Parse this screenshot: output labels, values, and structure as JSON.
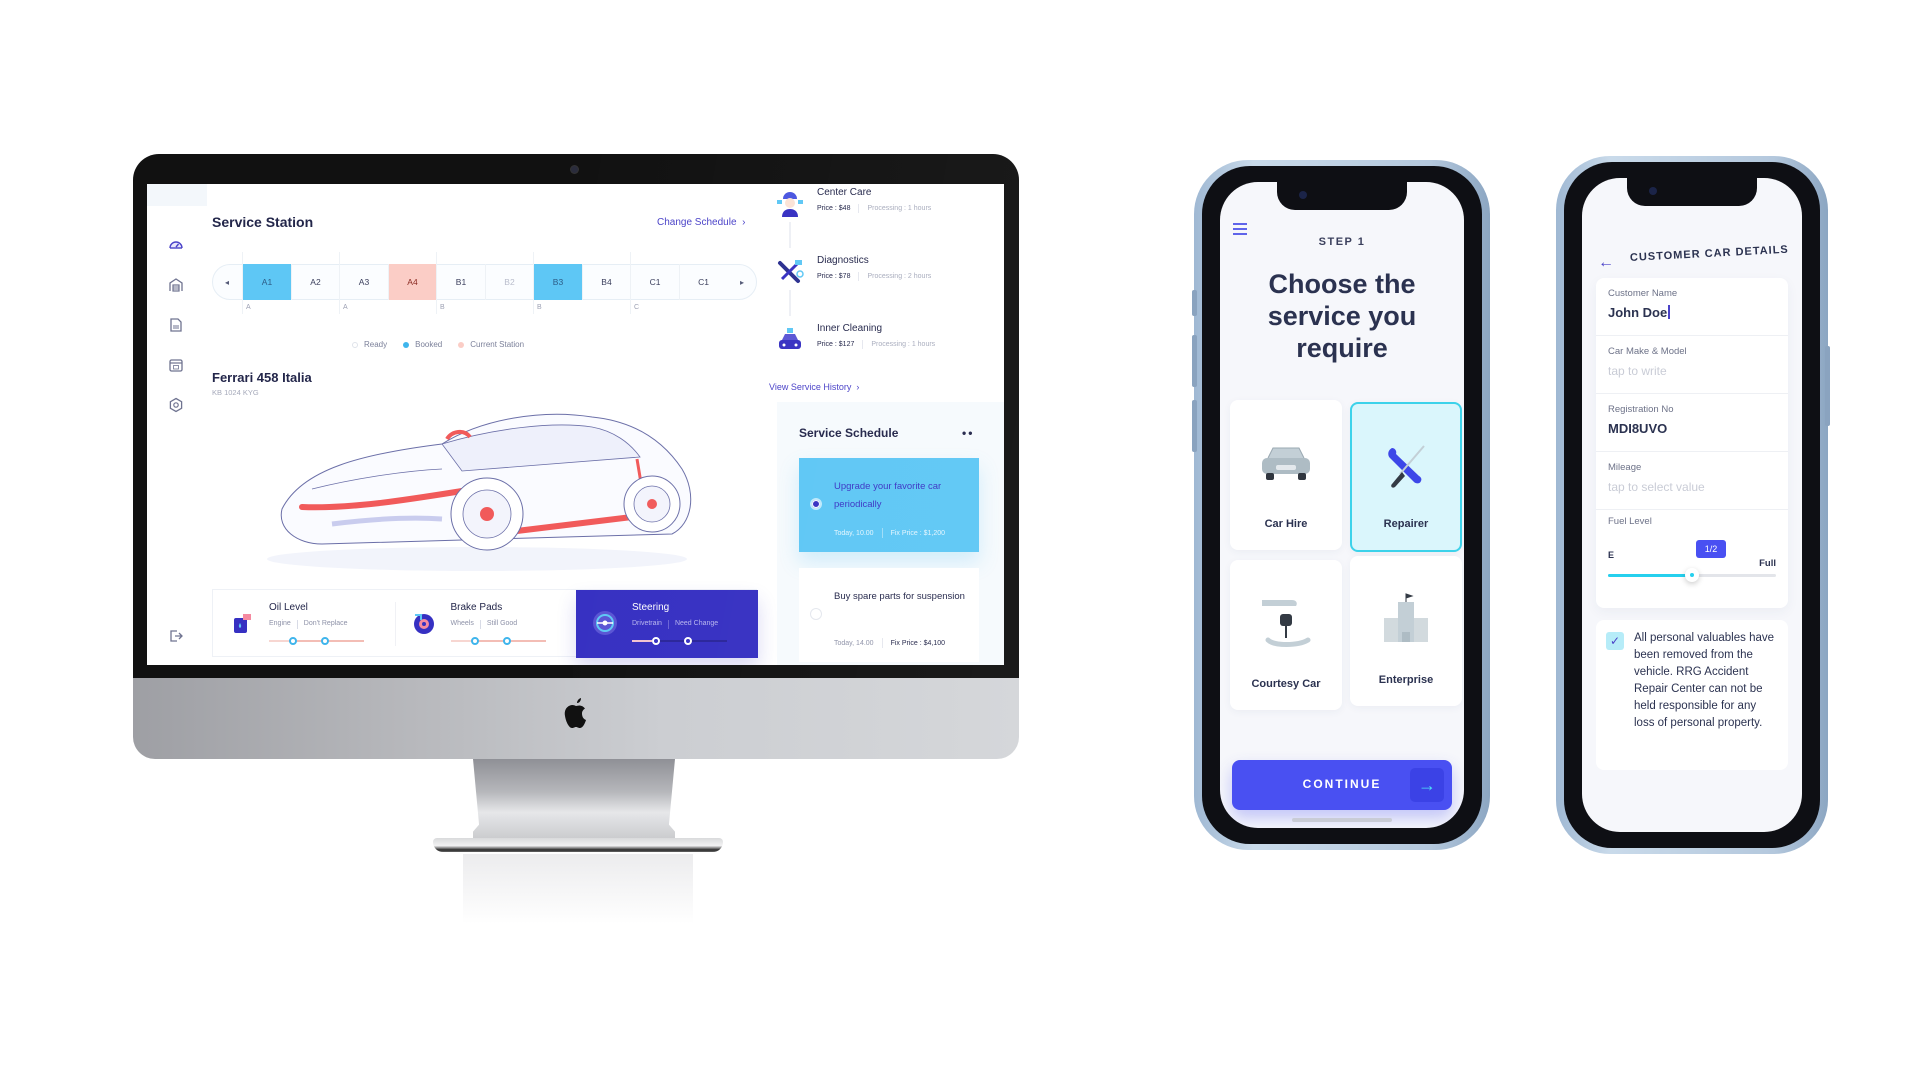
{
  "desktop": {
    "sidebar": {
      "items": [
        {
          "name": "dashboard",
          "icon": "speedometer-icon",
          "active": true
        },
        {
          "name": "garage",
          "icon": "garage-icon",
          "active": false
        },
        {
          "name": "documents",
          "icon": "document-icon",
          "active": false
        },
        {
          "name": "calendar",
          "icon": "calendar-icon",
          "active": false
        },
        {
          "name": "settings",
          "icon": "gear-icon",
          "active": false
        }
      ],
      "logout_icon": "logout-icon"
    },
    "service_station": {
      "title": "Service Station",
      "change_schedule_label": "Change Schedule",
      "change_schedule_chevron": "›",
      "prev_label": "◂",
      "next_label": "▸",
      "slots": [
        {
          "label": "A1",
          "state": "booked"
        },
        {
          "label": "A2",
          "state": "ready"
        },
        {
          "label": "A3",
          "state": "ready"
        },
        {
          "label": "A4",
          "state": "current"
        },
        {
          "label": "B1",
          "state": "ready"
        },
        {
          "label": "B2",
          "state": "disabled"
        },
        {
          "label": "B3",
          "state": "booked"
        },
        {
          "label": "B4",
          "state": "ready"
        },
        {
          "label": "C1",
          "state": "ready"
        },
        {
          "label": "C1",
          "state": "ready"
        }
      ],
      "group_labels": [
        "A",
        "A",
        "B",
        "B",
        "C"
      ],
      "legend": [
        {
          "label": "Ready",
          "color": "#ffffff"
        },
        {
          "label": "Booked",
          "color": "#3fb5ec"
        },
        {
          "label": "Current Station",
          "color": "#fbcdc6"
        }
      ]
    },
    "vehicle": {
      "name": "Ferrari 458 Italia",
      "plate": "KB 1024 KYG"
    },
    "status_cards": [
      {
        "title": "Oil Level",
        "category": "Engine",
        "status": "Don't Replace",
        "icon": "oil-can-icon",
        "active": false
      },
      {
        "title": "Brake Pads",
        "category": "Wheels",
        "status": "Still Good",
        "icon": "brake-disc-icon",
        "active": false
      },
      {
        "title": "Steering",
        "category": "Drivetrain",
        "status": "Need Change",
        "icon": "steering-wheel-icon",
        "active": true
      }
    ],
    "services": [
      {
        "name": "Center Care",
        "price": "Price : $48",
        "processing": "Processing : 1 hours",
        "icon": "mechanic-icon"
      },
      {
        "name": "Diagnostics",
        "price": "Price : $78",
        "processing": "Processing : 2 hours",
        "icon": "wrench-screwdriver-icon"
      },
      {
        "name": "Inner Cleaning",
        "price": "Price : $127",
        "processing": "Processing : 1 hours",
        "icon": "car-wash-icon"
      }
    ],
    "view_history_label": "View Service History",
    "view_history_chevron": "›",
    "schedule": {
      "title": "Service Schedule",
      "more_label": "••",
      "items": [
        {
          "text": "Upgrade your favorite car periodically",
          "time": "Today, 10.00",
          "price": "Fix Price : $1,200",
          "selected": true
        },
        {
          "text": "Buy spare parts for suspension",
          "time": "Today, 14.00",
          "price": "Fix Price : $4,100",
          "selected": false
        }
      ]
    },
    "colors": {
      "accent": "#3630c2",
      "booked": "#5ec7f5",
      "current": "#fbcdc6",
      "highlight": "#f15a5a"
    }
  },
  "phone_service": {
    "step_label": "STEP 1",
    "headline": "Choose the service you require",
    "options": [
      {
        "label": "Car Hire",
        "icon": "car-icon",
        "selected": false
      },
      {
        "label": "Repairer",
        "icon": "wrench-screwdriver-icon",
        "selected": true
      },
      {
        "label": "Courtesy Car",
        "icon": "car-key-handover-icon",
        "selected": false
      },
      {
        "label": "Enterprise",
        "icon": "office-building-icon",
        "selected": false
      }
    ],
    "continue_label": "CONTINUE",
    "continue_arrow": "→",
    "menu_icon": "hamburger-menu-icon"
  },
  "phone_details": {
    "title": "CUSTOMER CAR DETAILS",
    "back_arrow": "←",
    "fields": [
      {
        "label": "Customer Name",
        "value": "John Doe",
        "placeholder": ""
      },
      {
        "label": "Car Make & Model",
        "value": "",
        "placeholder": "tap to write"
      },
      {
        "label": "Registration No",
        "value": "MDI8UVO",
        "placeholder": ""
      },
      {
        "label": "Mileage",
        "value": "",
        "placeholder": "tap to select value"
      }
    ],
    "fuel": {
      "label": "Fuel Level",
      "min_label": "E",
      "max_label": "Full",
      "value_label": "1/2",
      "value": 0.5
    },
    "consent": {
      "checked": true,
      "check_glyph": "✓",
      "text": "All personal valuables have been removed from the vehicle. RRG Accident Repair Center can not be held responsible for any loss of personal property."
    }
  }
}
